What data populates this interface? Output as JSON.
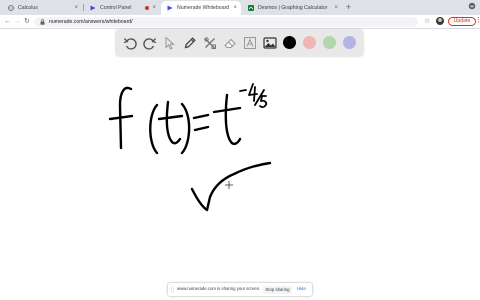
{
  "browser": {
    "tabs": [
      {
        "title": "Calculus",
        "active": false
      },
      {
        "title": "Control Panel",
        "active": false,
        "recording": true
      },
      {
        "title": "Numerade Whiteboard",
        "active": true
      },
      {
        "title": "Desmos | Graphing Calculator",
        "active": false
      }
    ],
    "new_tab_symbol": "+",
    "url": "numerade.com/answers/whiteboard/",
    "update_label": "Update",
    "menu_symbol": "⋮"
  },
  "whiteboard": {
    "tools": [
      "undo-icon",
      "redo-icon",
      "pointer-icon",
      "pen-icon",
      "shapes-icon",
      "eraser-icon",
      "text-icon",
      "image-icon"
    ],
    "colors": [
      "#000000",
      "#f0b5b5",
      "#b3d7ad",
      "#b3b3e8"
    ],
    "active_color": "#000000",
    "handwriting": "f(t) = t^(-4/5)",
    "sketch": "square root symbol"
  },
  "screen_share": {
    "message": "www.numerade.com is sharing your screen.",
    "stop_label": "Stop sharing",
    "hide_label": "Hide"
  }
}
